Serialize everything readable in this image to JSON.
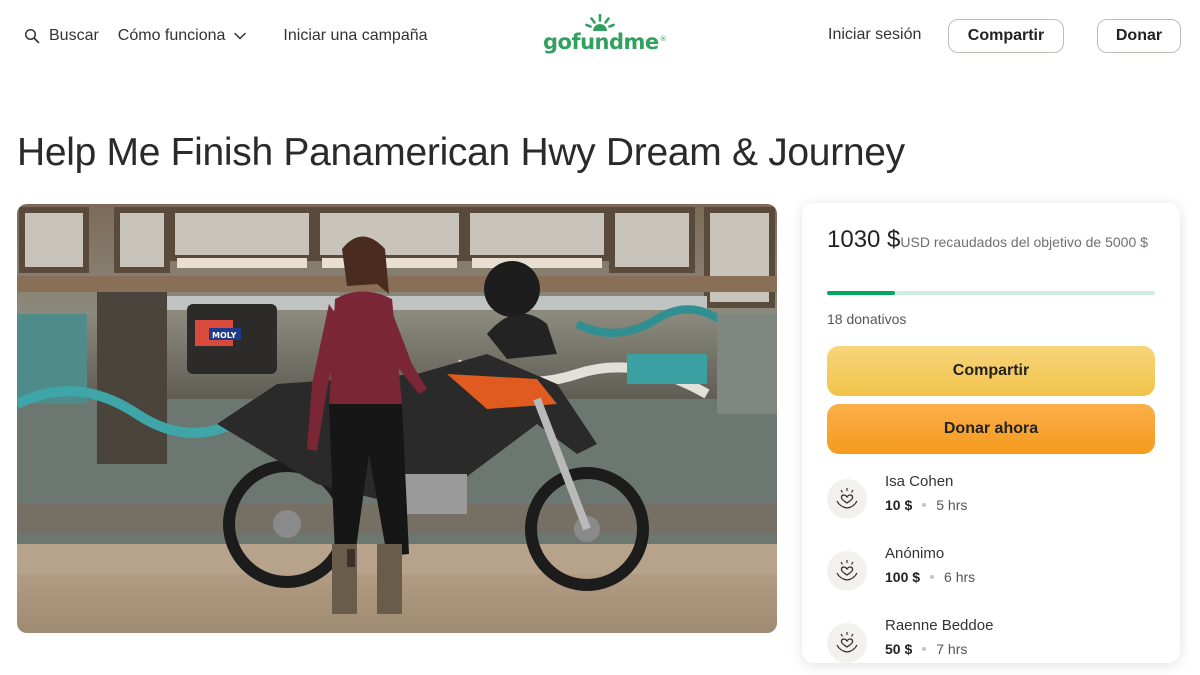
{
  "header": {
    "search_label": "Buscar",
    "how_it_works_label": "Cómo funciona",
    "start_campaign_label": "Iniciar una campaña",
    "logo_text": "gofundme",
    "login_label": "Iniciar sesión",
    "share_label": "Compartir",
    "donate_label": "Donar"
  },
  "campaign": {
    "title": "Help Me Finish Panamerican Hwy Dream & Journey",
    "image_sticker_text": "MOLY"
  },
  "card": {
    "raised_amount": "1030 $",
    "raised_text": "USD recaudados del objetivo de 5000 $",
    "progress_fraction": 0.206,
    "donations_count": "18 donativos",
    "share_button": "Compartir",
    "donate_button": "Donar ahora",
    "donors": [
      {
        "name": "Isa Cohen",
        "amount": "10 $",
        "time": "5 hrs"
      },
      {
        "name": "Anónimo",
        "amount": "100 $",
        "time": "6 hrs"
      },
      {
        "name": "Raenne Beddoe",
        "amount": "50 $",
        "time": "7 hrs"
      }
    ]
  },
  "icons": {
    "search": "search-icon",
    "chevron": "chevron-down-icon",
    "donor": "heart-hands-icon"
  },
  "colors": {
    "brand_green": "#32a05f",
    "progress_green": "#02a95c",
    "share_yellow": "#f1c34a",
    "donate_orange": "#f59a1c"
  }
}
